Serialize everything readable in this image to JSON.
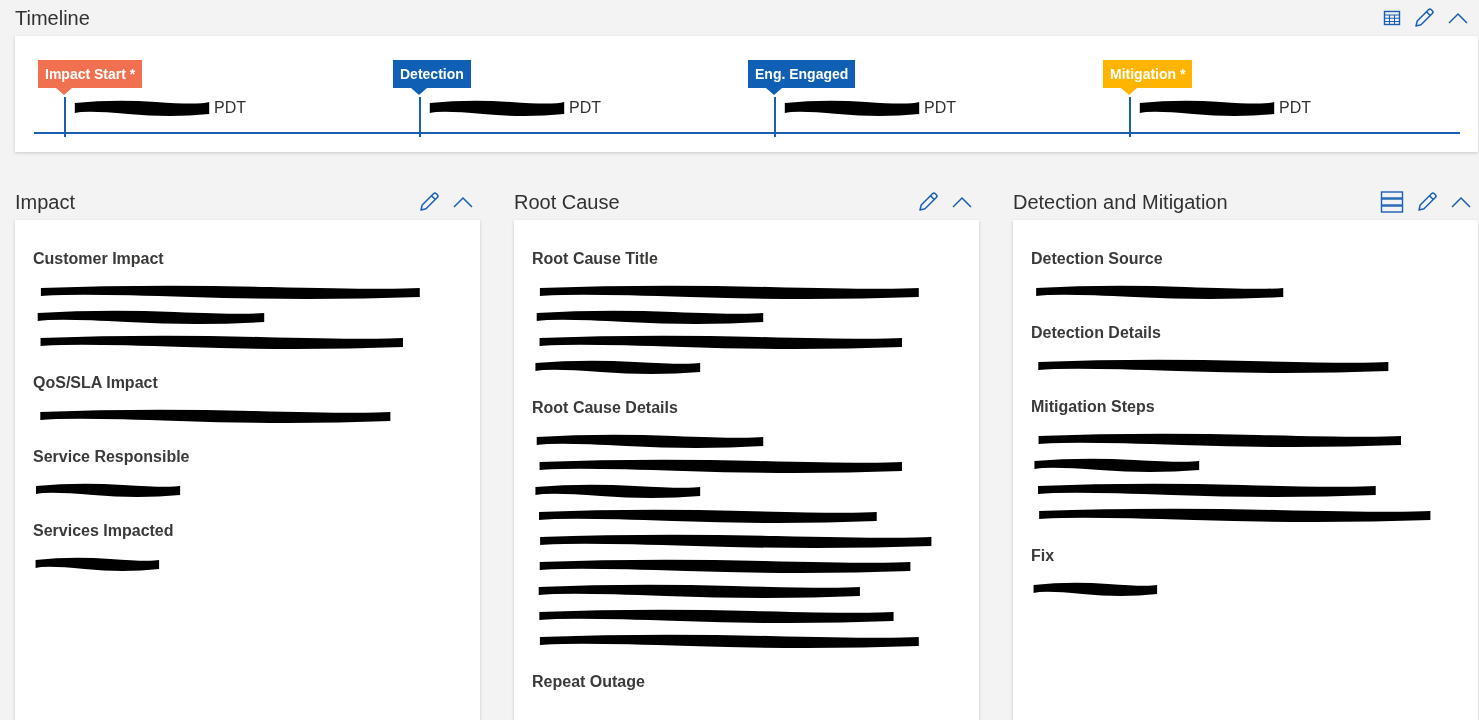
{
  "timeline": {
    "title": "Timeline",
    "actions": [
      {
        "kind": "table"
      },
      {
        "kind": "edit"
      },
      {
        "kind": "collapse"
      }
    ],
    "events": [
      {
        "label": "Impact Start *",
        "color": "#f07050",
        "time_suffix": "PDT",
        "time_redacted": true
      },
      {
        "label": "Detection",
        "color": "#0f5fb4",
        "time_suffix": "PDT",
        "time_redacted": true
      },
      {
        "label": "Eng. Engaged",
        "color": "#0f5fb4",
        "time_suffix": "PDT",
        "time_redacted": true
      },
      {
        "label": "Mitigation *",
        "color": "#ffb400",
        "time_suffix": "PDT",
        "time_redacted": true
      }
    ]
  },
  "sections": [
    {
      "title": "Impact",
      "actions": [
        {
          "kind": "edit"
        },
        {
          "kind": "collapse"
        }
      ],
      "fields": [
        {
          "label": "Customer Impact",
          "lines": [
            {
              "kind": "redaction"
            },
            {
              "kind": "redaction"
            },
            {
              "kind": "redaction"
            }
          ]
        },
        {
          "label": "QoS/SLA Impact",
          "lines": [
            {
              "kind": "redaction"
            }
          ]
        },
        {
          "label": "Service Responsible",
          "lines": [
            {
              "kind": "redaction"
            }
          ]
        },
        {
          "label": "Services Impacted",
          "lines": [
            {
              "kind": "redaction"
            }
          ]
        }
      ]
    },
    {
      "title": "Root Cause",
      "actions": [
        {
          "kind": "edit"
        },
        {
          "kind": "collapse"
        }
      ],
      "fields": [
        {
          "label": "Root Cause Title",
          "lines": [
            {
              "kind": "redaction"
            },
            {
              "kind": "redaction"
            },
            {
              "kind": "redaction"
            },
            {
              "kind": "redaction"
            }
          ]
        },
        {
          "label": "Root Cause Details",
          "lines": [
            {
              "kind": "redaction"
            },
            {
              "kind": "redaction"
            },
            {
              "kind": "redaction"
            },
            {
              "kind": "redaction"
            },
            {
              "kind": "redaction"
            },
            {
              "kind": "redaction"
            },
            {
              "kind": "redaction"
            },
            {
              "kind": "redaction"
            },
            {
              "kind": "redaction"
            }
          ]
        },
        {
          "label": "Repeat Outage"
        }
      ]
    },
    {
      "title": "Detection and Mitigation",
      "actions": [
        {
          "kind": "list"
        },
        {
          "kind": "edit"
        },
        {
          "kind": "collapse"
        }
      ],
      "fields": [
        {
          "label": "Detection Source",
          "lines": [
            {
              "kind": "redaction"
            }
          ]
        },
        {
          "label": "Detection Details",
          "lines": [
            {
              "kind": "redaction"
            }
          ]
        },
        {
          "label": "Mitigation Steps",
          "lines": [
            {
              "kind": "redaction"
            },
            {
              "kind": "redaction"
            },
            {
              "kind": "redaction"
            },
            {
              "kind": "redaction"
            }
          ]
        },
        {
          "label": "Fix",
          "lines": [
            {
              "kind": "redaction"
            }
          ]
        }
      ]
    }
  ]
}
